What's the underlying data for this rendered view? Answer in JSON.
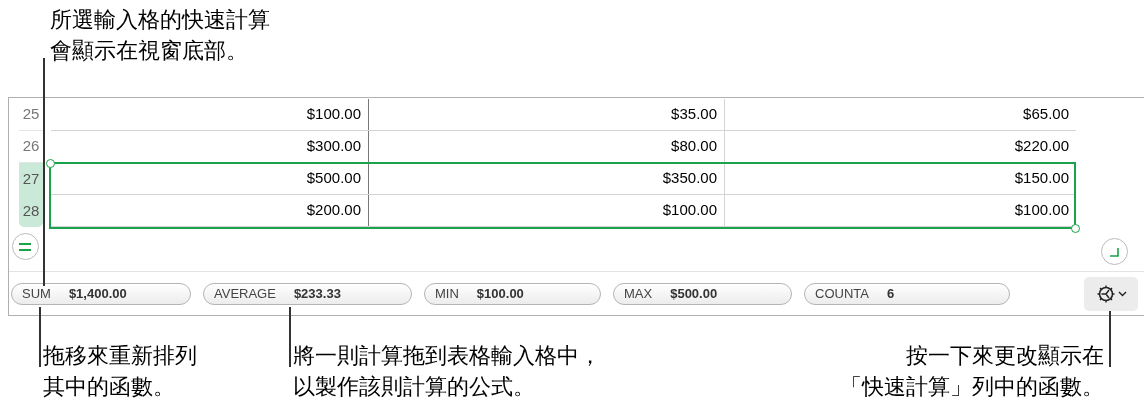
{
  "top_callout": {
    "lines": [
      "所選輸入格的快速計算",
      "會顯示在視窗底部。"
    ]
  },
  "table": {
    "rows": [
      {
        "number": "25",
        "selected": false,
        "cells": [
          "$100.00",
          "$35.00",
          "$65.00"
        ]
      },
      {
        "number": "26",
        "selected": false,
        "cells": [
          "$300.00",
          "$80.00",
          "$220.00"
        ]
      },
      {
        "number": "27",
        "selected": true,
        "cells": [
          "$500.00",
          "$350.00",
          "$150.00"
        ]
      },
      {
        "number": "28",
        "selected": true,
        "cells": [
          "$200.00",
          "$100.00",
          "$100.00"
        ]
      }
    ]
  },
  "quick_calc": [
    {
      "label": "SUM",
      "value": "$1,400.00"
    },
    {
      "label": "AVERAGE",
      "value": "$233.33"
    },
    {
      "label": "MIN",
      "value": "$100.00"
    },
    {
      "label": "MAX",
      "value": "$500.00"
    },
    {
      "label": "COUNTA",
      "value": "6"
    }
  ],
  "bottom_callouts": [
    {
      "lines": [
        "拖移來重新排列",
        "其中的函數。"
      ]
    },
    {
      "lines": [
        "將一則計算拖到表格輸入格中，",
        "以製作該則計算的公式。"
      ]
    },
    {
      "lines": [
        "按一下來更改顯示在",
        "「快速計算」列中的函數。"
      ]
    }
  ]
}
